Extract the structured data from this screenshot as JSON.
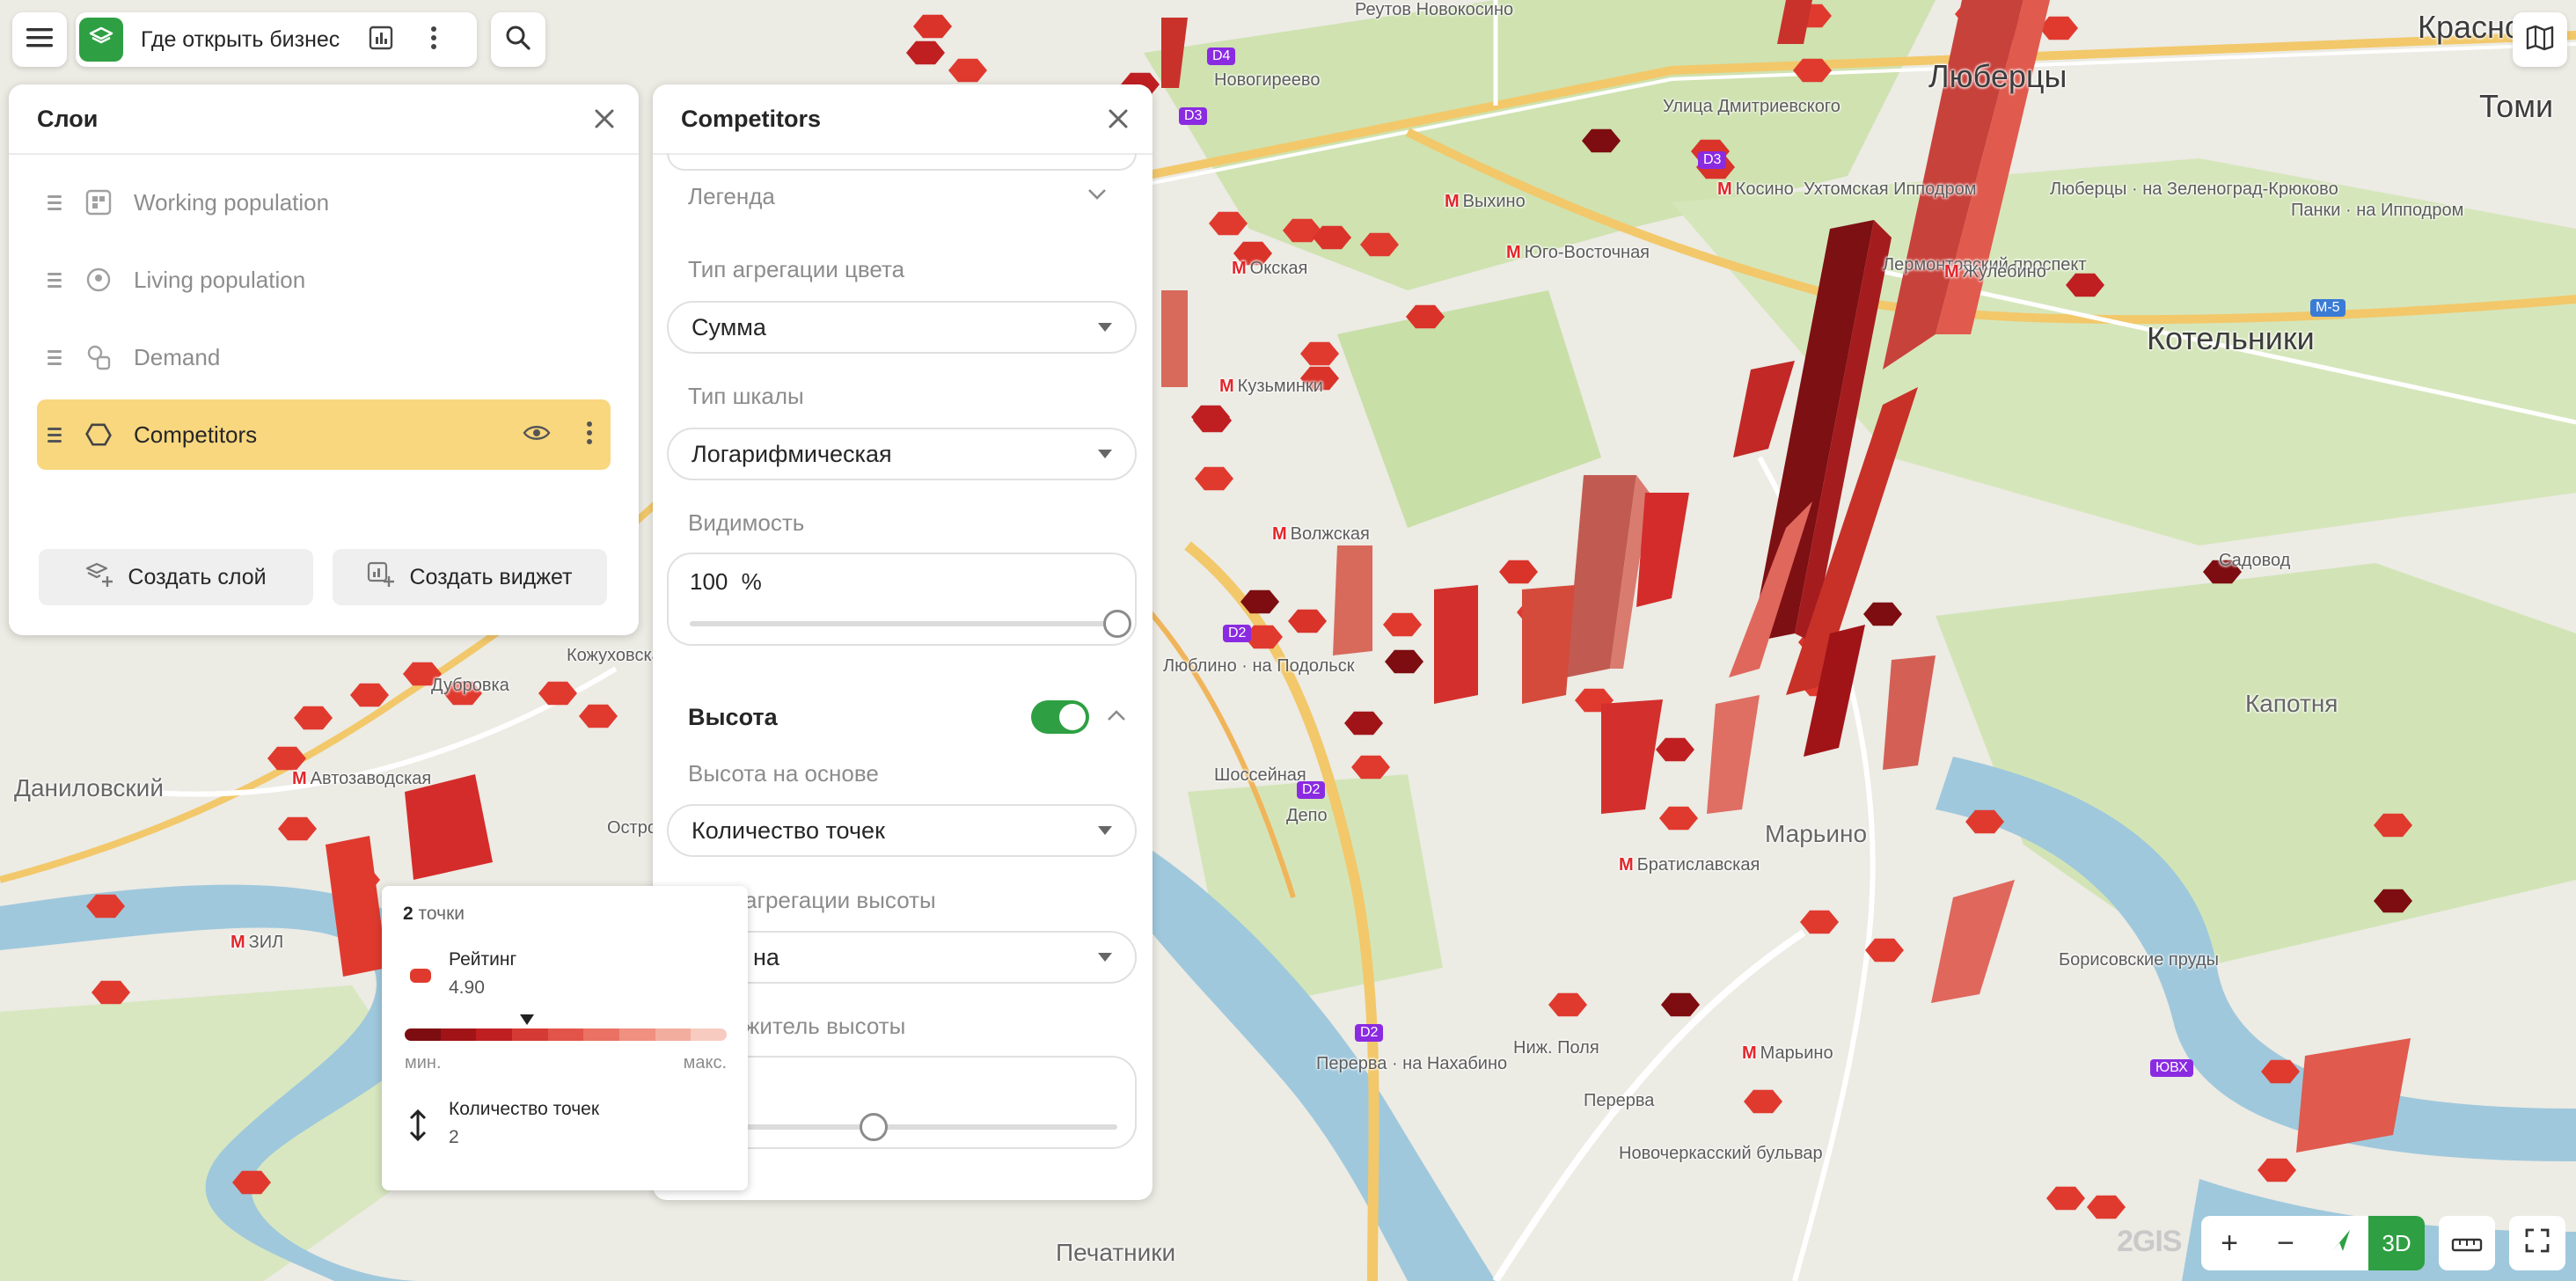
{
  "toolbar": {
    "menu_icon": "hamburger-icon",
    "layers_icon": "layers-icon",
    "title": "Где открыть бизнес",
    "dashboard_icon": "bar-chart-icon",
    "more_icon": "kebab-icon",
    "search_icon": "search-icon"
  },
  "layers_panel": {
    "title": "Слои",
    "layers": [
      {
        "name": "Working population",
        "icon": "building-grid-icon"
      },
      {
        "name": "Living population",
        "icon": "location-circle-icon"
      },
      {
        "name": "Demand",
        "icon": "demand-shapes-icon"
      },
      {
        "name": "Competitors",
        "icon": "hexagon-icon",
        "active": true
      }
    ],
    "create_layer": "Создать слой",
    "create_widget": "Создать виджет"
  },
  "competitors_panel": {
    "title": "Competitors",
    "legend": "Легенда",
    "color_agg_label": "Тип агрегации цвета",
    "color_agg_value": "Сумма",
    "scale_label": "Тип шкалы",
    "scale_value": "Логарифмическая",
    "visibility_label": "Видимость",
    "visibility_value": "100",
    "visibility_unit": "%",
    "visibility_fraction": 1.0,
    "height_title": "Высота",
    "height_enabled": true,
    "height_based_label": "Высота на основе",
    "height_based_value": "Количество точек",
    "height_agg_label_partial": "агрегации высоты",
    "height_agg_value_partial": "на",
    "height_mult_label_partial": "житель высоты",
    "height_mult_fraction": 0.43
  },
  "tooltip": {
    "count": "2",
    "count_unit": "точки",
    "rating_label": "Рейтинг",
    "rating_value": "4.90",
    "rating_position": 0.38,
    "min_label": "мин.",
    "max_label": "макс.",
    "points_label": "Количество точек",
    "points_value": "2",
    "scale_colors": [
      "#7d0d10",
      "#a01418",
      "#c01f22",
      "#d63a35",
      "#e2544a",
      "#ea7264",
      "#ef9080",
      "#f3ad9e",
      "#f7cbc0"
    ]
  },
  "map": {
    "labels": [
      {
        "text": "Реутов Новокосино",
        "kind": "small"
      },
      {
        "text": "Люберцы",
        "kind": "big"
      },
      {
        "text": "Краснов",
        "kind": "big"
      },
      {
        "text": "Томи",
        "kind": "big"
      },
      {
        "text": "Котельники",
        "kind": "big"
      },
      {
        "text": "Новогиреево",
        "kind": "small"
      },
      {
        "text": "Улица Дмитриевского",
        "kind": "small"
      },
      {
        "text": "Косино",
        "kind": "metro"
      },
      {
        "text": "Ухтомская Ипподром",
        "kind": "small"
      },
      {
        "text": "Люберцы · на Зеленоград-Крюково",
        "kind": "small"
      },
      {
        "text": "Панки · на Ипподром",
        "kind": "small"
      },
      {
        "text": "Выхино",
        "kind": "metro"
      },
      {
        "text": "Юго-Восточная",
        "kind": "metro"
      },
      {
        "text": "Лермонтовский проспект",
        "kind": "small"
      },
      {
        "text": "Жулебино",
        "kind": "metro"
      },
      {
        "text": "Окская",
        "kind": "metro"
      },
      {
        "text": "Кузьминки",
        "kind": "metro"
      },
      {
        "text": "Волжская",
        "kind": "metro"
      },
      {
        "text": "Садовод",
        "kind": "small"
      },
      {
        "text": "Люблино · на Подольск",
        "kind": "small"
      },
      {
        "text": "Капотня",
        "kind": "medium"
      },
      {
        "text": "Марьино",
        "kind": "medium"
      },
      {
        "text": "Братиславская",
        "kind": "metro"
      },
      {
        "text": "Депо",
        "kind": "small"
      },
      {
        "text": "Шоссейная",
        "kind": "small"
      },
      {
        "text": "Перерва · на Нахабино",
        "kind": "small"
      },
      {
        "text": "Марьино",
        "kind": "metro"
      },
      {
        "text": "Печатники",
        "kind": "medium"
      },
      {
        "text": "Даниловский",
        "kind": "medium"
      },
      {
        "text": "Автозаводская",
        "kind": "metro"
      },
      {
        "text": "ЗИЛ",
        "kind": "metro"
      },
      {
        "text": "Остров Мечты",
        "kind": "small"
      },
      {
        "text": "Кожуховская",
        "kind": "small"
      },
      {
        "text": "Дубровка",
        "kind": "small"
      },
      {
        "text": "Перерва",
        "kind": "small"
      },
      {
        "text": "Новочеркасский бульвар",
        "kind": "small"
      },
      {
        "text": "Борисовские пруды",
        "kind": "small"
      },
      {
        "text": "Ниж. Поля",
        "kind": "small"
      }
    ],
    "roads": [
      "D4",
      "D3",
      "D2",
      "М-5",
      "ЮВХ"
    ]
  },
  "controls": {
    "zoom_in": "+",
    "zoom_out": "−",
    "compass_icon": "compass-icon",
    "mode_3d": "3D",
    "ruler_icon": "ruler-icon",
    "fullscreen_icon": "fullscreen-icon",
    "map_type_icon": "map-icon",
    "brand": "2GIS"
  }
}
